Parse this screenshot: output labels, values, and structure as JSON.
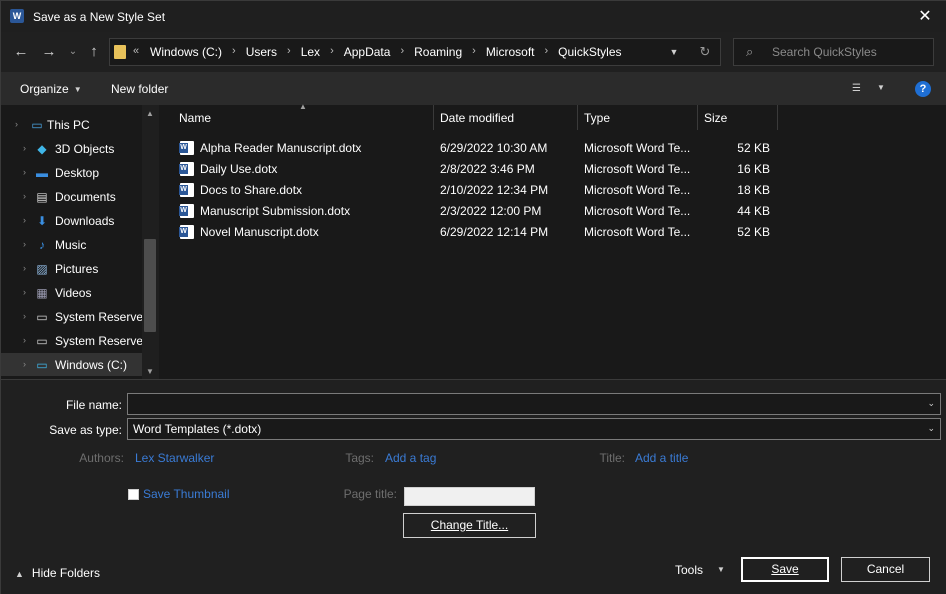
{
  "window": {
    "title": "Save as a New Style Set",
    "app_icon_letter": "W",
    "close_glyph": "✕"
  },
  "nav": {
    "back_glyph": "←",
    "forward_glyph": "→",
    "recent_glyph": "⌄",
    "up_glyph": "↑"
  },
  "address": {
    "lead": "«",
    "separator": "›",
    "crumbs": [
      "Windows (C:)",
      "Users",
      "Lex",
      "AppData",
      "Roaming",
      "Microsoft",
      "QuickStyles"
    ]
  },
  "search": {
    "placeholder": "Search QuickStyles"
  },
  "toolbar": {
    "organize_label": "Organize",
    "new_folder_label": "New folder",
    "help_label": "?"
  },
  "nav_pane": {
    "items": [
      {
        "label": "This PC",
        "icon": "computer-icon",
        "glyph": "▭",
        "color": "#4aa3df"
      },
      {
        "label": "3D Objects",
        "icon": "cube-icon",
        "glyph": "◆",
        "color": "#3fb6e8"
      },
      {
        "label": "Desktop",
        "icon": "desktop-icon",
        "glyph": "▬",
        "color": "#3a8ee0"
      },
      {
        "label": "Documents",
        "icon": "document-icon",
        "glyph": "▤",
        "color": "#d8d8d8"
      },
      {
        "label": "Downloads",
        "icon": "download-icon",
        "glyph": "⬇",
        "color": "#3a8ee0"
      },
      {
        "label": "Music",
        "icon": "music-icon",
        "glyph": "♪",
        "color": "#3a8ee0"
      },
      {
        "label": "Pictures",
        "icon": "pictures-icon",
        "glyph": "▨",
        "color": "#8fb8e0"
      },
      {
        "label": "Videos",
        "icon": "videos-icon",
        "glyph": "▦",
        "color": "#9a9ab0"
      },
      {
        "label": "System Reserved",
        "icon": "drive-icon",
        "glyph": "▭",
        "color": "#d0d0d0"
      },
      {
        "label": "System Reserved",
        "icon": "drive-icon",
        "glyph": "▭",
        "color": "#d0d0d0"
      },
      {
        "label": "Windows (C:)",
        "icon": "windows-drive-icon",
        "glyph": "▭",
        "color": "#3fb6e8"
      }
    ]
  },
  "file_list": {
    "columns": [
      "Name",
      "Date modified",
      "Type",
      "Size"
    ],
    "rows": [
      {
        "name": "Alpha Reader Manuscript.dotx",
        "date": "6/29/2022 10:30 AM",
        "type": "Microsoft Word Te...",
        "size": "52 KB"
      },
      {
        "name": "Daily Use.dotx",
        "date": "2/8/2022 3:46 PM",
        "type": "Microsoft Word Te...",
        "size": "16 KB"
      },
      {
        "name": "Docs to Share.dotx",
        "date": "2/10/2022 12:34 PM",
        "type": "Microsoft Word Te...",
        "size": "18 KB"
      },
      {
        "name": "Manuscript Submission.dotx",
        "date": "2/3/2022 12:00 PM",
        "type": "Microsoft Word Te...",
        "size": "44 KB"
      },
      {
        "name": "Novel Manuscript.dotx",
        "date": "6/29/2022 12:14 PM",
        "type": "Microsoft Word Te...",
        "size": "52 KB"
      }
    ]
  },
  "form": {
    "file_name_label": "File name:",
    "file_name_value": "",
    "save_type_label": "Save as type:",
    "save_type_value": "Word Templates (*.dotx)",
    "authors_label": "Authors:",
    "authors_value": "Lex Starwalker",
    "tags_label": "Tags:",
    "tags_value": "Add a tag",
    "title_label": "Title:",
    "title_value": "Add a title",
    "save_thumbnail_label": "Save Thumbnail",
    "page_title_label": "Page title:",
    "change_title_label": "Change Title..."
  },
  "footer": {
    "hide_folders_label": "Hide Folders",
    "tools_label": "Tools",
    "save_label": "Save",
    "cancel_label": "Cancel"
  }
}
